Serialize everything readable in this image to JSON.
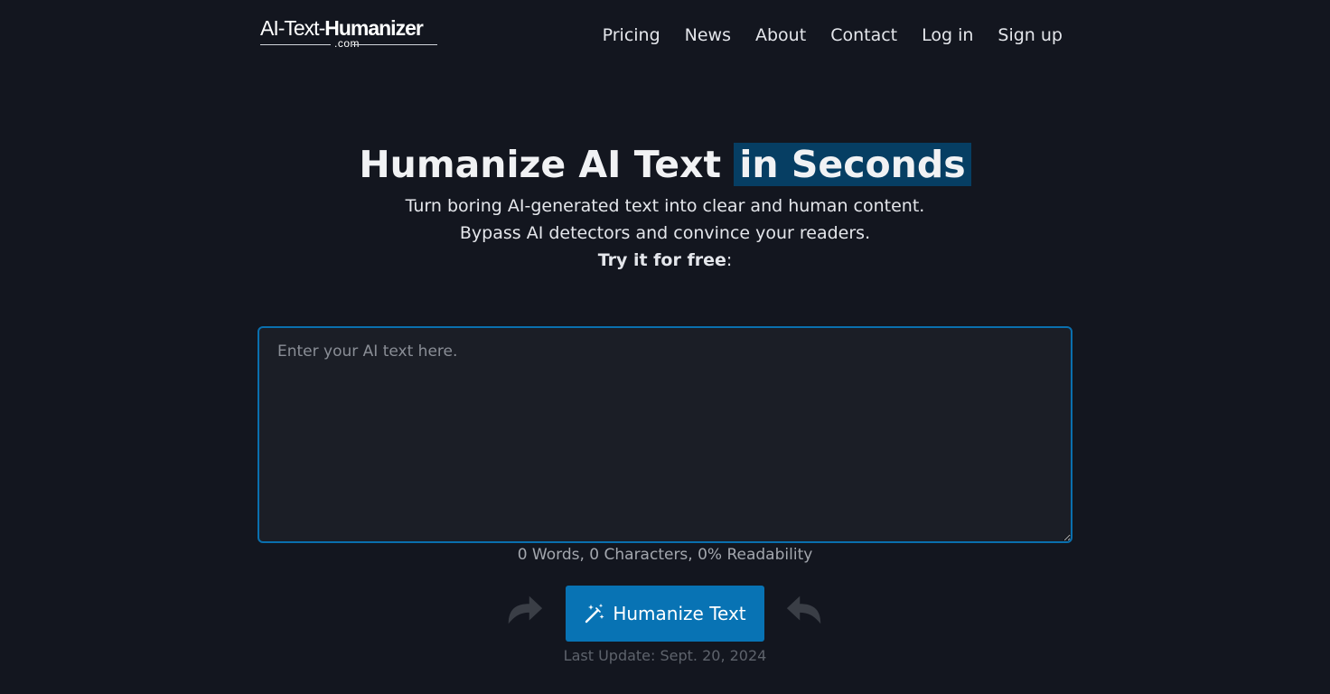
{
  "header": {
    "logo": {
      "part1": "AI-Text-",
      "part2": "Humanizer",
      "tld": ".com"
    },
    "nav": [
      {
        "label": "Pricing"
      },
      {
        "label": "News"
      },
      {
        "label": "About"
      },
      {
        "label": "Contact"
      },
      {
        "label": "Log in"
      },
      {
        "label": "Sign up"
      }
    ]
  },
  "hero": {
    "title_main": "Humanize AI Text ",
    "title_highlight": "in Seconds",
    "subtitle": "Turn boring AI-generated text into clear and human content. Bypass AI detectors and convince your readers.",
    "try_bold": "Try it for free",
    "try_suffix": ":"
  },
  "editor": {
    "value": "",
    "placeholder": "Enter your AI text here."
  },
  "stats": {
    "text": "0 Words, 0 Characters, 0% Readability"
  },
  "action": {
    "button_label": "Humanize Text",
    "button_icon": "magic-wand-icon",
    "left_arrow_icon": "curved-arrow-right-icon",
    "right_arrow_icon": "curved-arrow-left-icon"
  },
  "footer": {
    "last_update": "Last Update: Sept. 20, 2024"
  },
  "colors": {
    "background": "#13161f",
    "accent": "#0873b4",
    "highlight": "#063e63",
    "editor_border": "#0a6fae"
  }
}
